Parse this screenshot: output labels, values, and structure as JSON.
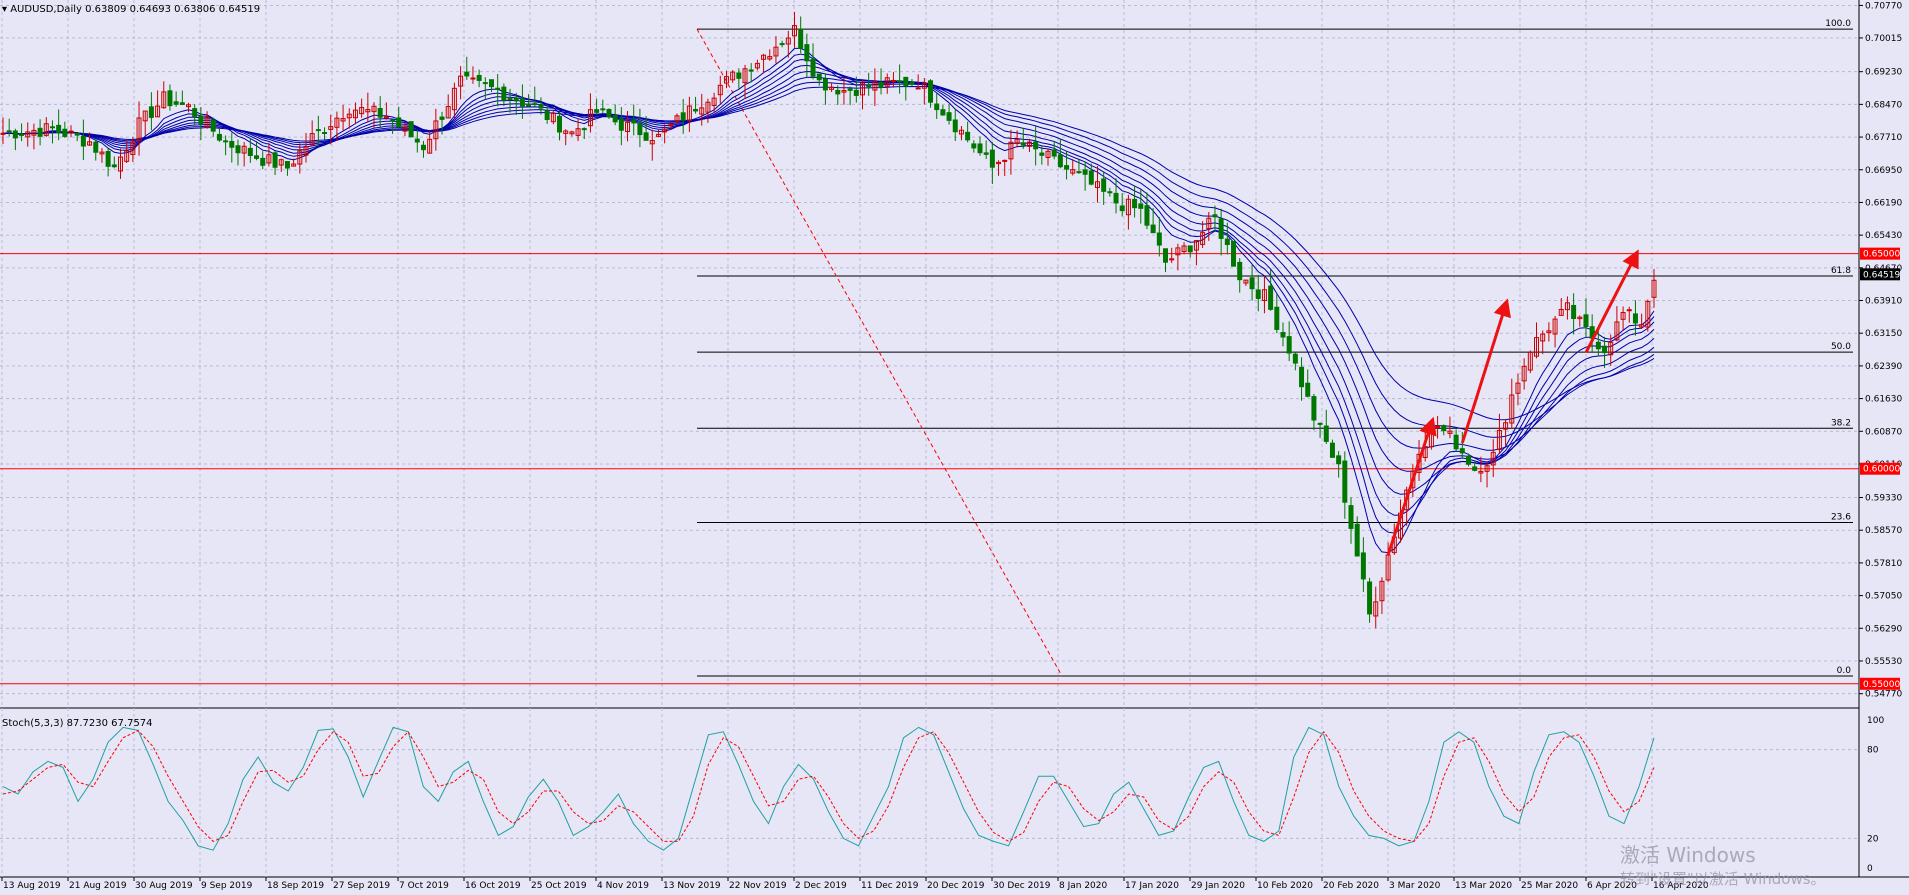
{
  "window": {
    "symbol": "AUDUSD,Daily",
    "ohlc": "0.63809 0.64693 0.63806 0.64519"
  },
  "indicator": {
    "label": "Stoch(5,3,3) 87.7230 67.7574",
    "levels": [
      "100",
      "80",
      "20",
      "0"
    ]
  },
  "watermark": {
    "line1": "激活 Windows",
    "line2": "转到\"设置\"以激活 Windows。"
  },
  "colors": {
    "background": "#e6e6f7",
    "grid": "#b9b9d6",
    "bull_candle": "#cc0000",
    "bear_candle": "#007700",
    "ema_ribbon": "#0000aa",
    "fib_line": "#000000",
    "level_line": "#ff0000",
    "stoch_main": "#20a0a0",
    "stoch_signal": "#ff0000",
    "arrow": "#ee1111"
  },
  "chart_data": {
    "type": "candlestick",
    "price_axis": {
      "min": 0.5446,
      "max": 0.7085,
      "ticks": [
        "0.70770",
        "0.70015",
        "0.69230",
        "0.68470",
        "0.67710",
        "0.66950",
        "0.66190",
        "0.65430",
        "0.64670",
        "0.63910",
        "0.63150",
        "0.62390",
        "0.61630",
        "0.60870",
        "0.60110",
        "0.59330",
        "0.58570",
        "0.57810",
        "0.57050",
        "0.56290",
        "0.55530",
        "0.54770"
      ]
    },
    "current_price": "0.64519",
    "horizontal_levels": [
      {
        "value": 0.65,
        "label": "0.65000"
      },
      {
        "value": 0.6,
        "label": "0.60000"
      },
      {
        "value": 0.55,
        "label": "0.55000"
      }
    ],
    "fibonacci": [
      {
        "level": "100.0",
        "price": 0.7022
      },
      {
        "level": "61.8",
        "price": 0.6448
      },
      {
        "level": "50.0",
        "price": 0.6271
      },
      {
        "level": "38.2",
        "price": 0.6094
      },
      {
        "level": "23.6",
        "price": 0.5875
      },
      {
        "level": "0.0",
        "price": 0.5518
      }
    ],
    "x_axis_labels": [
      "13 Aug 2019",
      "21 Aug 2019",
      "30 Aug 2019",
      "9 Sep 2019",
      "18 Sep 2019",
      "27 Sep 2019",
      "7 Oct 2019",
      "16 Oct 2019",
      "25 Oct 2019",
      "4 Nov 2019",
      "13 Nov 2019",
      "22 Nov 2019",
      "2 Dec 2019",
      "11 Dec 2019",
      "20 Dec 2019",
      "30 Dec 2019",
      "8 Jan 2020",
      "17 Jan 2020",
      "29 Jan 2020",
      "10 Feb 2020",
      "20 Feb 2020",
      "3 Mar 2020",
      "13 Mar 2020",
      "25 Mar 2020",
      "6 Apr 2020",
      "16 Apr 2020"
    ],
    "close_path": [
      [
        0,
        0.678
      ],
      [
        8,
        0.679
      ],
      [
        14,
        0.676
      ],
      [
        18,
        0.67
      ],
      [
        22,
        0.68
      ],
      [
        26,
        0.686
      ],
      [
        30,
        0.684
      ],
      [
        36,
        0.676
      ],
      [
        42,
        0.672
      ],
      [
        46,
        0.67
      ],
      [
        50,
        0.677
      ],
      [
        56,
        0.684
      ],
      [
        62,
        0.682
      ],
      [
        68,
        0.675
      ],
      [
        74,
        0.69
      ],
      [
        80,
        0.688
      ],
      [
        86,
        0.684
      ],
      [
        92,
        0.678
      ],
      [
        96,
        0.683
      ],
      [
        100,
        0.68
      ],
      [
        106,
        0.677
      ],
      [
        110,
        0.682
      ],
      [
        116,
        0.689
      ],
      [
        122,
        0.695
      ],
      [
        128,
        0.702
      ],
      [
        132,
        0.69
      ],
      [
        136,
        0.688
      ],
      [
        140,
        0.689
      ],
      [
        148,
        0.69
      ],
      [
        154,
        0.68
      ],
      [
        160,
        0.67
      ],
      [
        164,
        0.676
      ],
      [
        168,
        0.673
      ],
      [
        174,
        0.668
      ],
      [
        180,
        0.662
      ],
      [
        184,
        0.66
      ],
      [
        188,
        0.648
      ],
      [
        192,
        0.652
      ],
      [
        196,
        0.658
      ],
      [
        200,
        0.645
      ],
      [
        204,
        0.64
      ],
      [
        208,
        0.628
      ],
      [
        212,
        0.612
      ],
      [
        216,
        0.6
      ],
      [
        219,
        0.58
      ],
      [
        221,
        0.566
      ],
      [
        223,
        0.575
      ],
      [
        226,
        0.59
      ],
      [
        229,
        0.605
      ],
      [
        232,
        0.61
      ],
      [
        235,
        0.606
      ],
      [
        238,
        0.6
      ],
      [
        241,
        0.603
      ],
      [
        244,
        0.617
      ],
      [
        247,
        0.628
      ],
      [
        250,
        0.633
      ],
      [
        253,
        0.637
      ],
      [
        256,
        0.632
      ],
      [
        259,
        0.628
      ],
      [
        262,
        0.636
      ],
      [
        265,
        0.634
      ],
      [
        267,
        0.645
      ]
    ],
    "ema_offsets": [
      0.0,
      0.0018,
      0.0036,
      0.0054,
      0.0072,
      0.009,
      0.0108,
      0.0126
    ],
    "stochastic": {
      "k": [
        55,
        50,
        65,
        72,
        68,
        45,
        60,
        85,
        95,
        93,
        70,
        45,
        32,
        15,
        12,
        30,
        60,
        75,
        58,
        52,
        68,
        93,
        94,
        75,
        48,
        72,
        95,
        92,
        55,
        45,
        65,
        72,
        45,
        22,
        28,
        48,
        60,
        45,
        22,
        28,
        38,
        50,
        30,
        18,
        12,
        20,
        55,
        90,
        92,
        70,
        45,
        30,
        55,
        70,
        60,
        38,
        20,
        15,
        35,
        55,
        88,
        95,
        90,
        65,
        40,
        22,
        18,
        15,
        38,
        62,
        62,
        45,
        28,
        30,
        50,
        58,
        40,
        22,
        25,
        48,
        68,
        72,
        45,
        22,
        18,
        25,
        75,
        95,
        90,
        55,
        35,
        22,
        20,
        15,
        18,
        45,
        85,
        92,
        85,
        55,
        35,
        30,
        65,
        90,
        92,
        85,
        62,
        35,
        30,
        55,
        88
      ],
      "d": [
        50,
        52,
        60,
        68,
        70,
        58,
        55,
        72,
        88,
        93,
        82,
        62,
        45,
        28,
        18,
        22,
        45,
        65,
        66,
        58,
        62,
        80,
        92,
        85,
        62,
        64,
        82,
        92,
        75,
        55,
        58,
        66,
        60,
        38,
        30,
        38,
        52,
        52,
        38,
        30,
        32,
        42,
        38,
        28,
        18,
        18,
        35,
        70,
        88,
        82,
        62,
        42,
        45,
        60,
        62,
        48,
        30,
        20,
        25,
        42,
        68,
        88,
        92,
        78,
        58,
        38,
        24,
        18,
        24,
        45,
        58,
        55,
        40,
        32,
        38,
        50,
        48,
        32,
        26,
        35,
        55,
        65,
        58,
        38,
        25,
        22,
        48,
        78,
        92,
        78,
        52,
        35,
        25,
        20,
        18,
        30,
        62,
        85,
        88,
        72,
        50,
        38,
        48,
        75,
        88,
        90,
        75,
        52,
        38,
        45,
        68
      ]
    }
  }
}
